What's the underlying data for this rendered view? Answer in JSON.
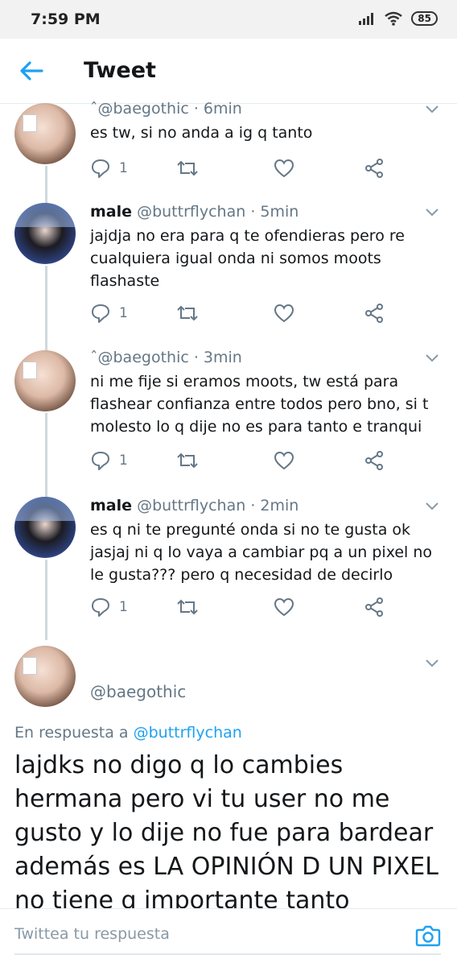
{
  "status_bar": {
    "time": "7:59 PM",
    "battery": "85"
  },
  "header": {
    "title": "Tweet"
  },
  "tweets": [
    {
      "name": "",
      "handle": "ˆ@baegothic",
      "time": "· 6min",
      "text": "es tw, si no anda a ig q tanto",
      "replies": "1"
    },
    {
      "name": "male",
      "handle": "@buttrflychan",
      "time": "· 5min",
      "text": "jajdja no era para q te ofendieras pero re cualquiera igual onda ni somos moots flashaste",
      "replies": "1"
    },
    {
      "name": "",
      "handle": "ˆ@baegothic",
      "time": "· 3min",
      "text": "ni me fije si eramos moots, tw está para flashear confianza entre todos pero bno, si t molesto lo q dije no es para tanto e tranqui",
      "replies": "1"
    },
    {
      "name": "male",
      "handle": "@buttrflychan",
      "time": "· 2min",
      "text": "es q ni te pregunté onda si no te gusta ok jasjaj ni q lo vaya a cambiar pq a un pixel no le gusta??? pero q necesidad de decirlo",
      "replies": "1"
    }
  ],
  "main_tweet": {
    "handle": "@baegothic",
    "reply_prefix": "En respuesta a",
    "reply_to": "@buttrflychan",
    "text": "lajdks no digo q lo cambies hermana pero vi tu user no me gusto y lo dije no fue para bardear además es LA OPINIÓN D UN PIXEL no tiene q importante tanto"
  },
  "compose": {
    "placeholder": "Twittea tu respuesta"
  },
  "colors": {
    "accent": "#1da1f2",
    "secondary_text": "#657786",
    "thread_line": "#cfd9de"
  }
}
